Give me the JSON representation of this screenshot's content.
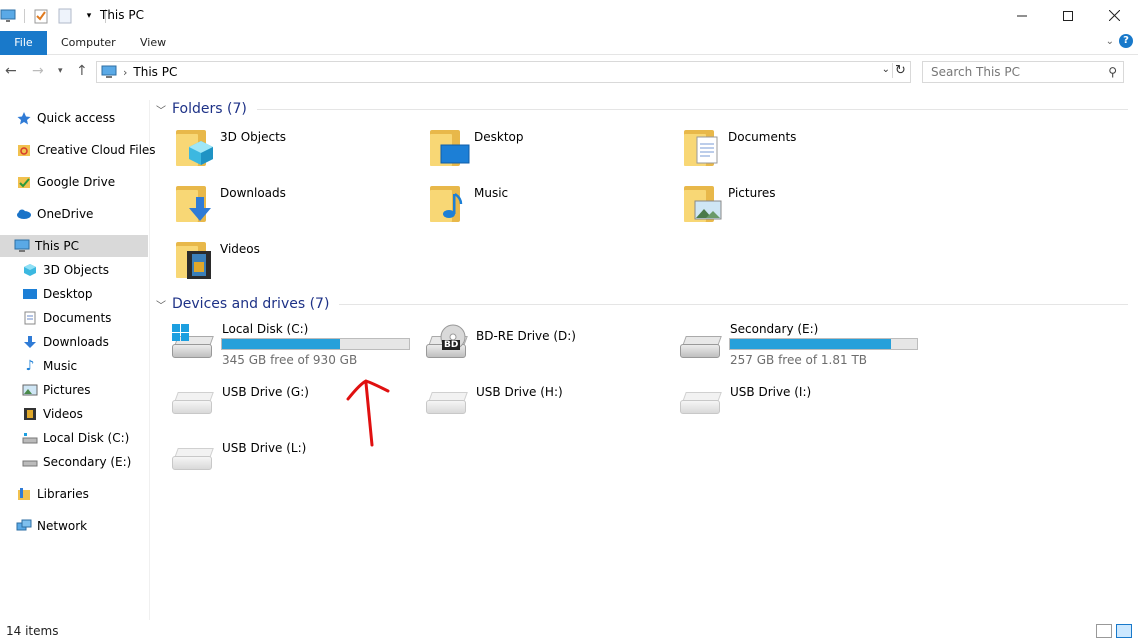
{
  "window": {
    "title": "This PC",
    "controls": {
      "minimize": "—",
      "maximize": "☐",
      "close": "✕"
    }
  },
  "ribbon": {
    "tabs": [
      "File",
      "Computer",
      "View"
    ],
    "help": "?"
  },
  "address": {
    "crumb": "This PC",
    "separator": "›",
    "search_placeholder": "Search This PC"
  },
  "navpane": {
    "items": [
      {
        "label": "Quick access",
        "icon": "star-icon"
      },
      {
        "label": "Creative Cloud Files",
        "icon": "creative-cloud-icon"
      },
      {
        "label": "Google Drive",
        "icon": "google-drive-icon"
      },
      {
        "label": "OneDrive",
        "icon": "onedrive-icon"
      },
      {
        "label": "This PC",
        "icon": "monitor-icon",
        "selected": true
      },
      {
        "label": "3D Objects",
        "icon": "cube-icon"
      },
      {
        "label": "Desktop",
        "icon": "desktop-icon"
      },
      {
        "label": "Documents",
        "icon": "document-icon"
      },
      {
        "label": "Downloads",
        "icon": "download-icon"
      },
      {
        "label": "Music",
        "icon": "music-icon"
      },
      {
        "label": "Pictures",
        "icon": "pictures-icon"
      },
      {
        "label": "Videos",
        "icon": "videos-icon"
      },
      {
        "label": "Local Disk (C:)",
        "icon": "disk-icon"
      },
      {
        "label": "Secondary (E:)",
        "icon": "disk-icon"
      },
      {
        "label": "Libraries",
        "icon": "libraries-icon"
      },
      {
        "label": "Network",
        "icon": "network-icon"
      }
    ]
  },
  "folders": {
    "header": "Folders (7)",
    "items": [
      "3D Objects",
      "Desktop",
      "Documents",
      "Downloads",
      "Music",
      "Pictures",
      "Videos"
    ]
  },
  "drives": {
    "header": "Devices and drives (7)",
    "local_c": {
      "name": "Local Disk (C:)",
      "sub": "345 GB free of 930 GB",
      "used_fraction": 0.63
    },
    "bd_d": {
      "name": "BD-RE Drive (D:)",
      "badge": "BD"
    },
    "secondary_e": {
      "name": "Secondary (E:)",
      "sub": "257 GB free of 1.81 TB",
      "used_fraction": 0.86
    },
    "usb_g": {
      "name": "USB Drive (G:)"
    },
    "usb_h": {
      "name": "USB Drive (H:)"
    },
    "usb_i": {
      "name": "USB Drive (I:)"
    },
    "usb_l": {
      "name": "USB Drive (L:)"
    }
  },
  "status": {
    "count": "14 items"
  },
  "colors": {
    "accent": "#1979ca",
    "bar_fill": "#26a0da",
    "group_title": "#1e3287",
    "annotation": "#e01010"
  }
}
